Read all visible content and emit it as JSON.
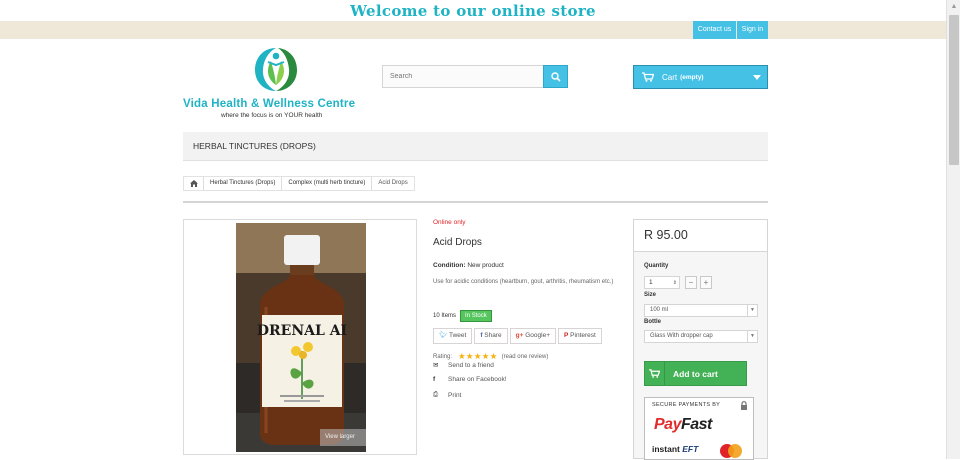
{
  "welcome": {
    "text": "Welcome to our online store"
  },
  "topnav": {
    "contact": "Contact us",
    "signin": "Sign in"
  },
  "logo": {
    "name": "Vida Health & Wellness Centre",
    "tagline": "where the focus is on YOUR health"
  },
  "search": {
    "placeholder": "Search"
  },
  "cart": {
    "label": "Cart",
    "status": "(empty)"
  },
  "menu": {
    "item": "HERBAL TINCTURES (DROPS)"
  },
  "breadcrumb": {
    "items": [
      "Herbal Tinctures (Drops)",
      "Complex (multi herb tincture)",
      "Acid Drops"
    ]
  },
  "image": {
    "bottle_label": "DRENAL AI",
    "zoom_label": "View larger"
  },
  "product": {
    "online_only": "Online only",
    "name": "Acid Drops",
    "condition_label": "Condition:",
    "condition_value": "New product",
    "description": "Use for acidic conditions (heartburn, gout, arthritis, rheumatism etc.)",
    "stock_count": "10",
    "stock_unit": "Items",
    "stock_status": "In Stock",
    "social": [
      "Tweet",
      "Share",
      "Google+",
      "Pinterest"
    ],
    "rating_label": "Rating:",
    "rating": 5,
    "stars_text": "★★★★★",
    "read_review": "(read one review)",
    "send_friend": "Send to a friend",
    "share_fb": "Share on Facebook!",
    "print": "Print"
  },
  "buy": {
    "price": "R 95.00",
    "quantity_label": "Quantity",
    "quantity_value": "1",
    "size_label": "Size",
    "size_value": "100 ml",
    "bottle_label": "Bottle",
    "bottle_value": "Glass With dropper cap",
    "add_to_cart": "Add to cart",
    "secure_title": "SECURE PAYMENTS BY",
    "payfast_pay": "Pay",
    "payfast_fast": "Fast",
    "instant": "instant",
    "eft": "EFT"
  },
  "colors": {
    "accent": "#45c1e6",
    "brand_teal": "#1fb3c4",
    "green": "#43b155",
    "topbar": "#efe8d9"
  }
}
